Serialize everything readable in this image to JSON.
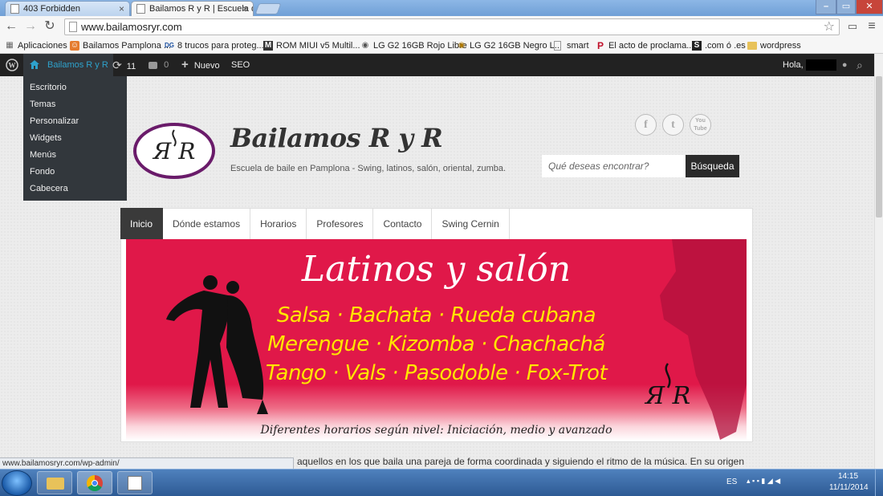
{
  "browser": {
    "tabs": [
      {
        "title": "403 Forbidden",
        "active": false
      },
      {
        "title": "Bailamos R y R | Escuela d",
        "active": true
      }
    ],
    "url": "www.bailamosryr.com",
    "bookmarks": [
      {
        "label": "Aplicaciones",
        "icon": "apps-grid-icon"
      },
      {
        "label": "Bailamos Pamplona ...",
        "icon": "site-favicon"
      },
      {
        "label": "8 trucos para proteg...",
        "icon": "dg-favicon"
      },
      {
        "label": "ROM MIUI v5 Multil...",
        "icon": "miui-favicon"
      },
      {
        "label": "LG G2 16GB Rojo Libre",
        "icon": "lg-favicon"
      },
      {
        "label": "LG G2 16GB Negro L...",
        "icon": "lg-favicon"
      },
      {
        "label": "smart",
        "icon": "page-icon"
      },
      {
        "label": "El acto de proclama...",
        "icon": "p-favicon"
      },
      {
        "label": ".com ó .es",
        "icon": "s-favicon"
      },
      {
        "label": "wordpress",
        "icon": "folder-icon"
      }
    ]
  },
  "adminbar": {
    "site_name": "Bailamos R y R",
    "updates_count": "11",
    "comments_count": "0",
    "new_label": "Nuevo",
    "seo_label": "SEO",
    "greeting": "Hola,",
    "site_menu": [
      "Escritorio",
      "Temas",
      "Personalizar",
      "Widgets",
      "Menús",
      "Fondo",
      "Cabecera"
    ]
  },
  "site": {
    "title": "Bailamos R y R",
    "tagline": "Escuela de baile en Pamplona - Swing, latinos, salón, oriental, zumba.",
    "search_placeholder": "Qué deseas encontrar?",
    "search_button": "Búsqueda",
    "social": [
      "f",
      "t",
      "You Tube"
    ]
  },
  "nav": {
    "items": [
      {
        "label": "Inicio",
        "active": true
      },
      {
        "label": "Dónde estamos",
        "active": false
      },
      {
        "label": "Horarios",
        "active": false
      },
      {
        "label": "Profesores",
        "active": false
      },
      {
        "label": "Contacto",
        "active": false
      },
      {
        "label": "Swing Cernin",
        "active": false
      }
    ]
  },
  "banner": {
    "title": "Latinos y salón",
    "lines": [
      "Salsa · Bachata · Rueda cubana",
      "Merengue · Kizomba · Chachachá",
      "Tango · Vals · Pasodoble · Fox-Trot"
    ],
    "footer": "Diferentes horarios según nivel: Iniciación, medio y avanzado",
    "colors": {
      "background": "#e01849",
      "title": "#ffffff",
      "dances": "#ffe600"
    }
  },
  "body_text": "n aquellos en los que baila una pareja de forma coordinada y siguiendo el ritmo de la música. En su origen",
  "status_url": "www.bailamosryr.com/wp-admin/",
  "taskbar": {
    "lang": "ES",
    "time": "14:15",
    "date": "11/11/2014"
  }
}
